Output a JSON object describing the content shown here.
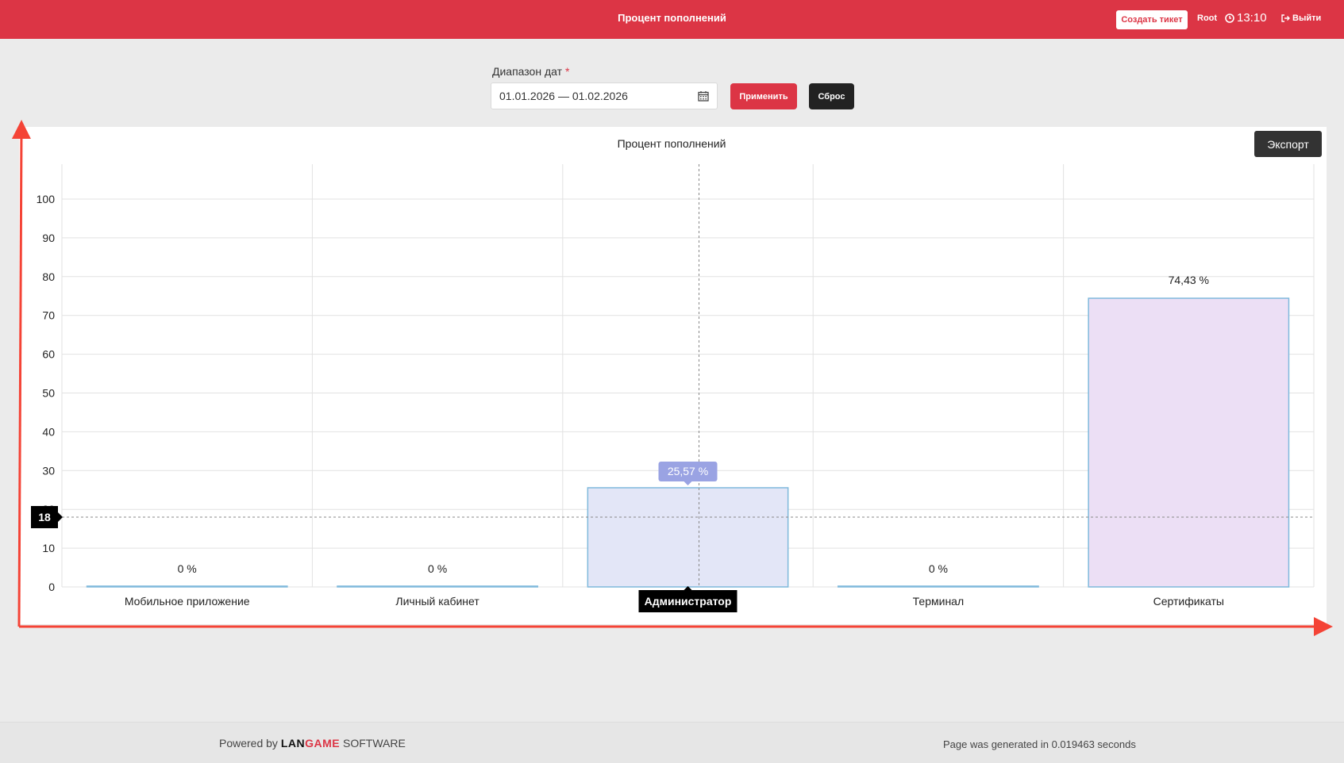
{
  "header": {
    "title": "Процент пополнений",
    "ticket_label": "Создать тикет",
    "user": "Root",
    "time": "13:10",
    "logout_label": "Выйти"
  },
  "filter": {
    "label": "Диапазон дат",
    "required_mark": "*",
    "date_range": "01.01.2026 — 01.02.2026",
    "apply_label": "Применить",
    "reset_label": "Сброс"
  },
  "export_label": "Экспорт",
  "chart_data": {
    "type": "bar",
    "title": "Процент пополнений",
    "categories": [
      "Мобильное приложение",
      "Личный кабинет",
      "Администратор",
      "Терминал",
      "Сертификаты"
    ],
    "values": [
      0,
      0,
      25.57,
      0,
      74.43
    ],
    "data_labels": [
      "0 %",
      "0 %",
      "25,57 %",
      "0 %",
      "74,43 %"
    ],
    "ylim": [
      0,
      100
    ],
    "yticks": [
      0,
      10,
      20,
      30,
      40,
      50,
      60,
      70,
      80,
      90,
      100
    ],
    "grid": true,
    "bar_fill_colors": [
      "#e3e6f7",
      "#e3e6f7",
      "#e3e6f7",
      "#e3e6f7",
      "#ecdff5"
    ],
    "bar_stroke_color": "#7fb9dc",
    "tooltip": {
      "category_index": 2,
      "label": "25,57 %",
      "color": "#9aa3e3"
    },
    "highlighted_category": "Администратор",
    "crosshair_y_label": "18",
    "crosshair_y_value": 18
  },
  "footer": {
    "powered_prefix": "Powered by",
    "brand_part1": "LAN",
    "brand_part2": "GAME",
    "brand_suffix": "SOFTWARE",
    "generated": "Page was generated in 0.019463 seconds"
  },
  "colors": {
    "accent": "#dc3545",
    "dark": "#222222",
    "annotation_arrow": "#f44336"
  }
}
